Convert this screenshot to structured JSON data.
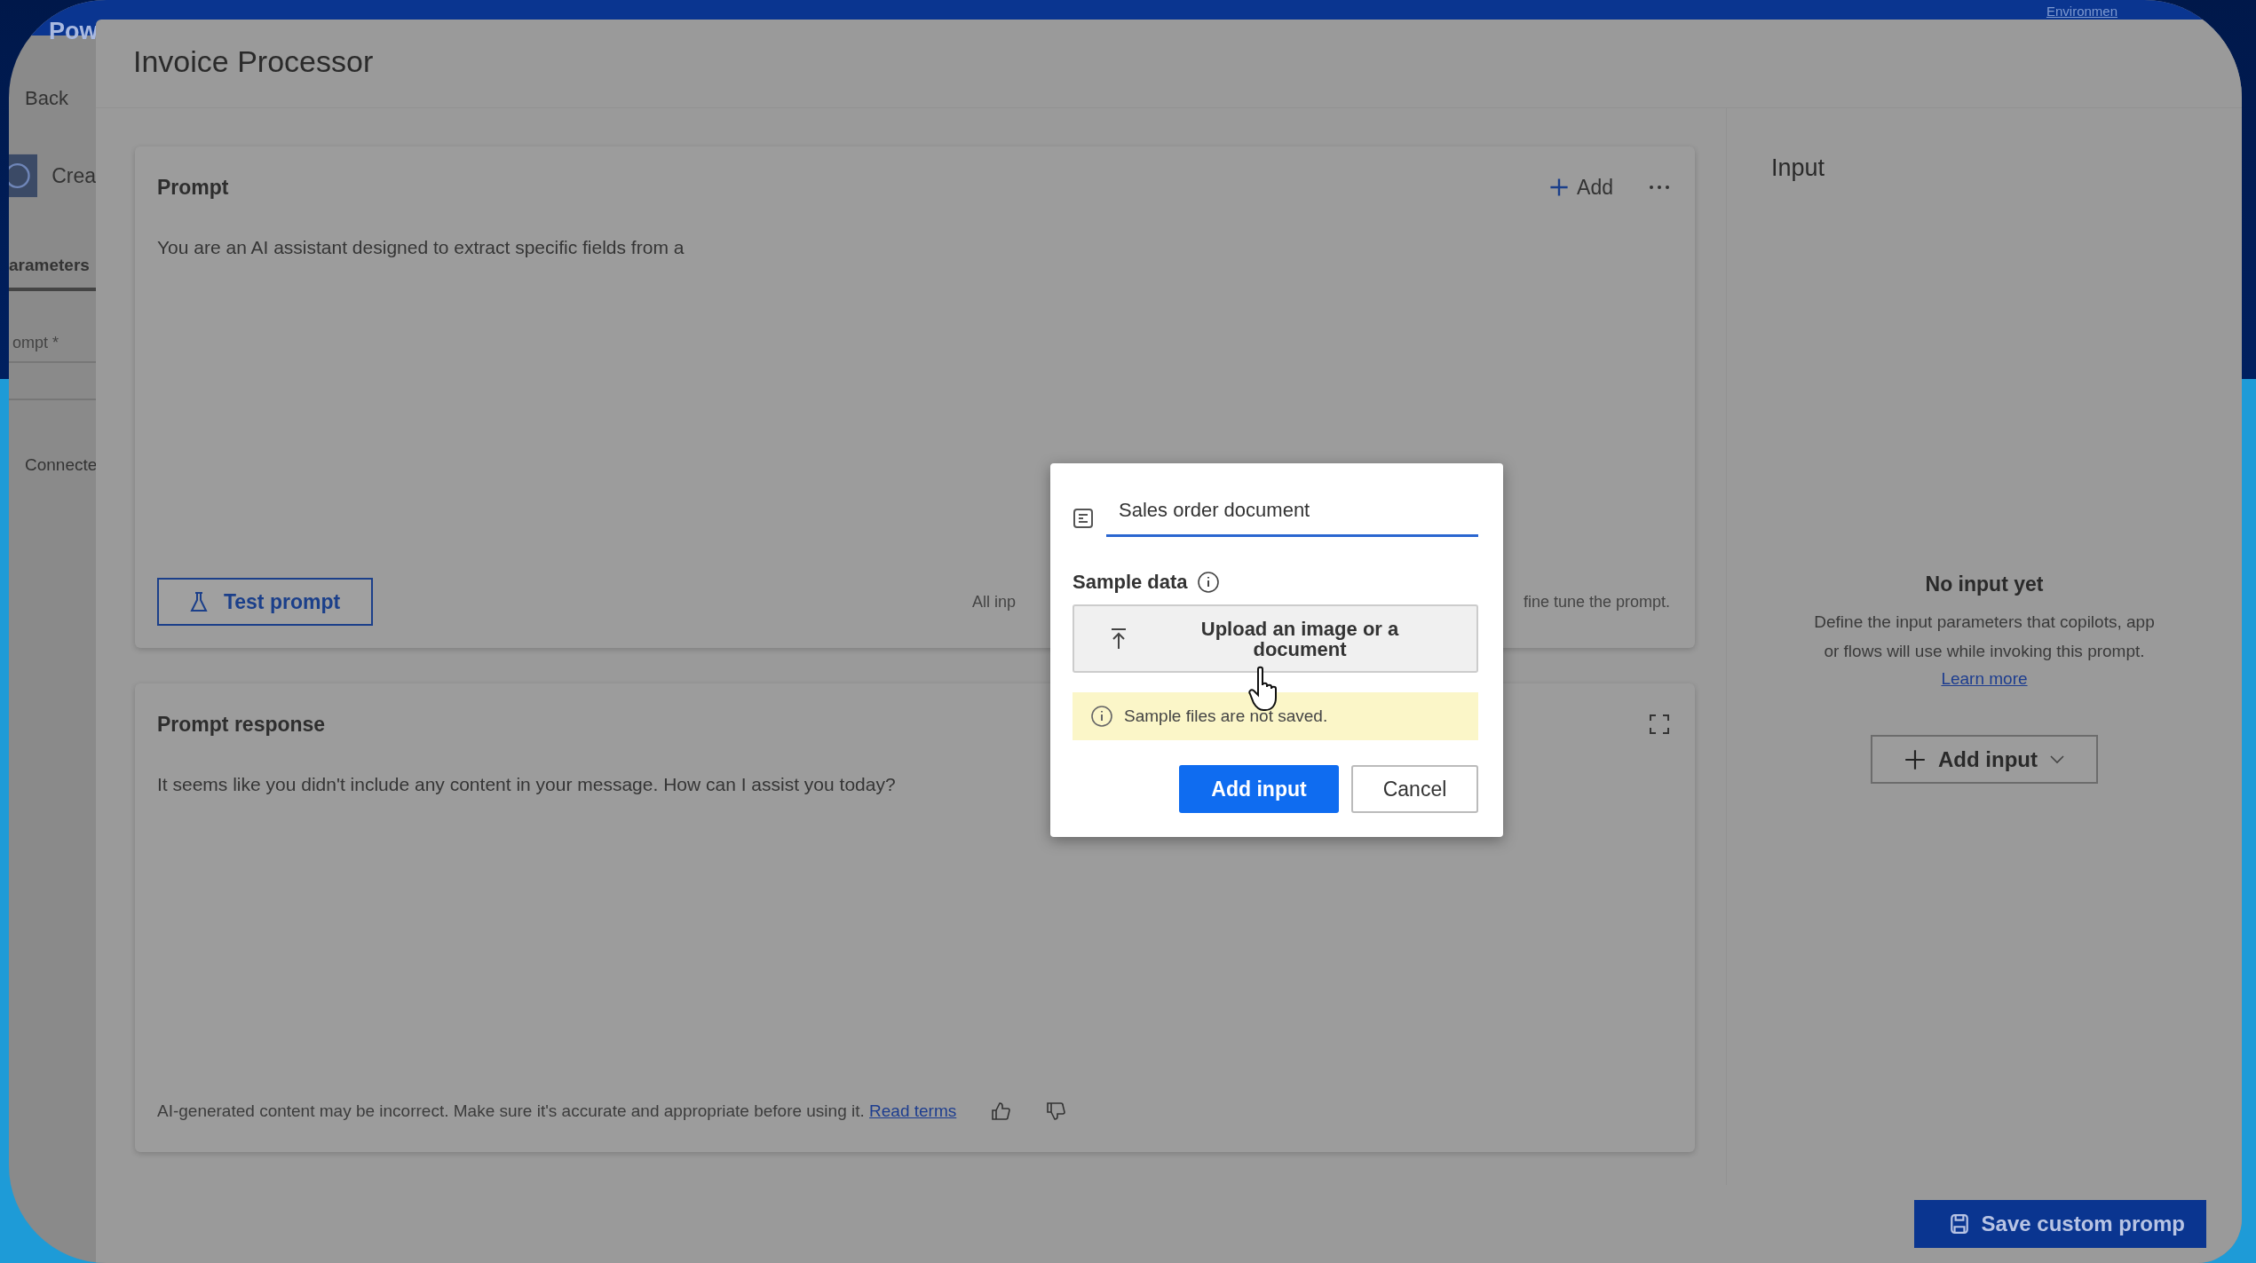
{
  "app_header": {
    "brand": "Pow",
    "environment": "Environmen"
  },
  "left_nav": {
    "back": "Back",
    "app_name": "Crea",
    "tabs": [
      {
        "label": "arameters",
        "selected": true
      }
    ],
    "field_label": "ompt *",
    "connection": "Connecte"
  },
  "panel": {
    "title": "Invoice Processor"
  },
  "prompt_card": {
    "title": "Prompt",
    "add_button": "Add",
    "text": "You are an AI assistant designed to extract specific fields from a",
    "test_button": "Test prompt",
    "hint_left": "All inp",
    "hint_right": "fine tune the prompt."
  },
  "response_card": {
    "title": "Prompt response",
    "text": "It seems like you didn't include any content in your message. How can I assist you today?",
    "disclaimer": "AI-generated content may be incorrect. Make sure it's accurate and appropriate before using it.",
    "link": "Read terms"
  },
  "input_panel": {
    "title": "Input",
    "empty_title": "No input yet",
    "description_lines": [
      "Define the input parameters that copilots, app",
      "or flows will use while invoking this prompt."
    ],
    "link": "Learn more",
    "add_button": "Add input"
  },
  "save_button": "Save custom promp",
  "dialog": {
    "name_value": "Sales order document",
    "sample_label": "Sample data",
    "upload_label": "Upload an image or a document",
    "notice": "Sample files are not saved.",
    "primary_button": "Add input",
    "cancel_button": "Cancel"
  }
}
